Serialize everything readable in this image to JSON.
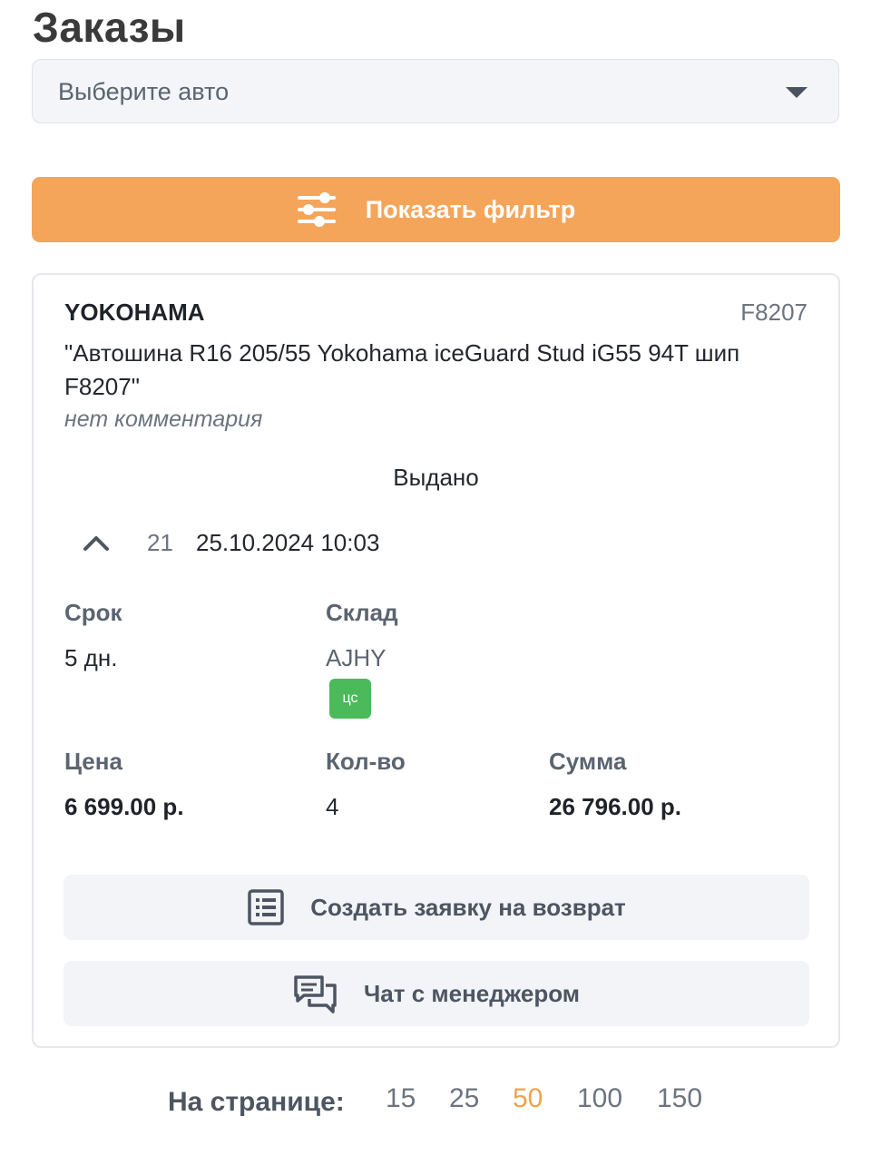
{
  "header": {
    "title": "Заказы"
  },
  "car_select": {
    "placeholder": "Выберите авто"
  },
  "filter_button": {
    "label": "Показать фильтр"
  },
  "order": {
    "brand": "YOKOHAMA",
    "sku": "F8207",
    "product": "\"Автошина R16 205/55 Yokohama iceGuard Stud iG55 94T шип F8207\"",
    "comment": "нет комментария",
    "status": "Выдано",
    "number": "21",
    "date": "25.10.2024 10:03",
    "term_label": "Срок",
    "term_value": "5 дн.",
    "warehouse_label": "Склад",
    "warehouse_value": "AJHY",
    "warehouse_badge": "цс",
    "price_label": "Цена",
    "price_value": "6 699.00 р.",
    "qty_label": "Кол-во",
    "qty_value": "4",
    "sum_label": "Сумма",
    "sum_value": "26 796.00 р.",
    "return_button": "Создать заявку на возврат",
    "chat_button": "Чат с менеджером"
  },
  "pager": {
    "label": "На странице:",
    "options": [
      "15",
      "25",
      "50",
      "100",
      "150"
    ],
    "selected": "50"
  },
  "colors": {
    "accent": "#f4a55a",
    "badge_green": "#4bba5a",
    "selected_page": "#f0a24e"
  },
  "icons": {
    "select_arrow": "caret-down-icon",
    "filter": "sliders-icon",
    "collapse": "chevron-up-icon",
    "return": "list-icon",
    "chat": "chat-bubbles-icon"
  }
}
